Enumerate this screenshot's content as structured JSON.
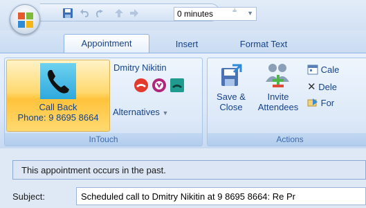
{
  "quick_access": {
    "duration_value": "0 minutes",
    "customize_label": "⫨"
  },
  "tabs": [
    {
      "label": "Appointment"
    },
    {
      "label": "Insert"
    },
    {
      "label": "Format Text"
    }
  ],
  "intouch": {
    "call_back_label": "Call Back",
    "phone_label": "Phone: 9 8695 8664",
    "contact_name": "Dmitry Nikitin",
    "alternatives_label": "Alternatives",
    "group_label": "InTouch"
  },
  "actions": {
    "save_close_line1": "Save &",
    "save_close_line2": "Close",
    "invite_line1": "Invite",
    "invite_line2": "Attendees",
    "calendar_label": "Cale",
    "delete_label": "Dele",
    "forward_label": "For",
    "group_label": "Actions"
  },
  "infobar": {
    "message": "This appointment occurs in the past."
  },
  "subject": {
    "label": "Subject:",
    "value": "Scheduled call to Dmitry Nikitin at 9 8695 8664: Re Pr"
  },
  "colors": {
    "accent": "#15428b",
    "ribbon_bg": "#dbe8f8",
    "highlight": "#ffd96f"
  }
}
